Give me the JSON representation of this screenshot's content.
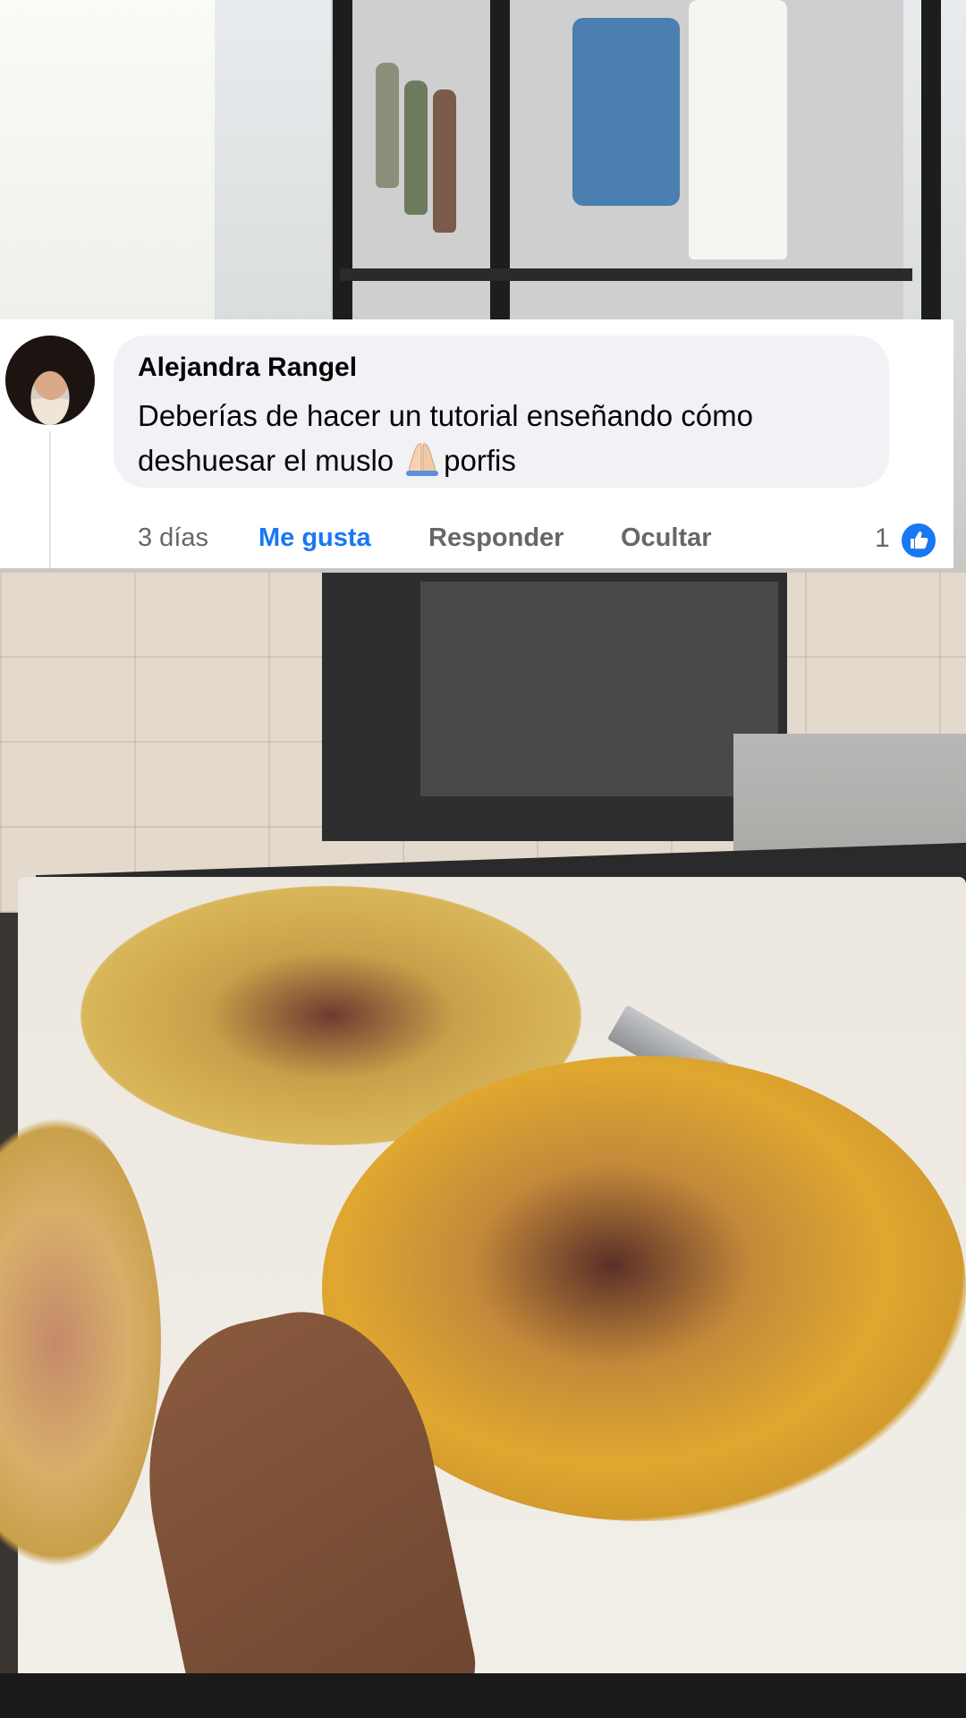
{
  "comment": {
    "author": "Alejandra Rangel",
    "text": "Deberías de hacer un tutorial enseñando cómo deshuesar el muslo",
    "emoji": "folded-hands-emoji",
    "text_suffix": "porfis",
    "time": "3 días",
    "like_label": "Me gusta",
    "reply_label": "Responder",
    "hide_label": "Ocultar",
    "reaction_count": "1",
    "reaction_icon": "like-thumb-icon",
    "like_color": "#1877f2"
  },
  "colors": {
    "bubble": "#f0f2f5",
    "muted_text": "#65676b",
    "primary_text": "#050505"
  }
}
